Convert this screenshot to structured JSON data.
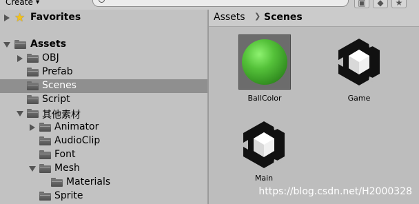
{
  "toolbar": {
    "create_label": "Create",
    "search_value": "",
    "search_placeholder": ""
  },
  "tree": {
    "favorites": "Favorites",
    "assets": "Assets",
    "items": [
      {
        "label": "OBJ"
      },
      {
        "label": "Prefab"
      },
      {
        "label": "Scenes"
      },
      {
        "label": "Script"
      },
      {
        "label": "其他素材"
      },
      {
        "label": "Animator"
      },
      {
        "label": "AudioClip"
      },
      {
        "label": "Font"
      },
      {
        "label": "Mesh"
      },
      {
        "label": "Materials"
      },
      {
        "label": "Sprite"
      }
    ],
    "selected": "Scenes"
  },
  "breadcrumb": {
    "root": "Assets",
    "separator": "❯",
    "current": "Scenes"
  },
  "assets": [
    {
      "label": "BallColor",
      "icon": "material-sphere-icon"
    },
    {
      "label": "Game",
      "icon": "unity-scene-icon"
    },
    {
      "label": "Main",
      "icon": "unity-scene-icon"
    }
  ],
  "watermark": "https://blog.csdn.net/H2000328",
  "colors": {
    "panel_bg": "#c2c2c2",
    "selection": "#8f8f8f",
    "folder": "#5e5e5e",
    "ball_green": "#4fb536"
  }
}
